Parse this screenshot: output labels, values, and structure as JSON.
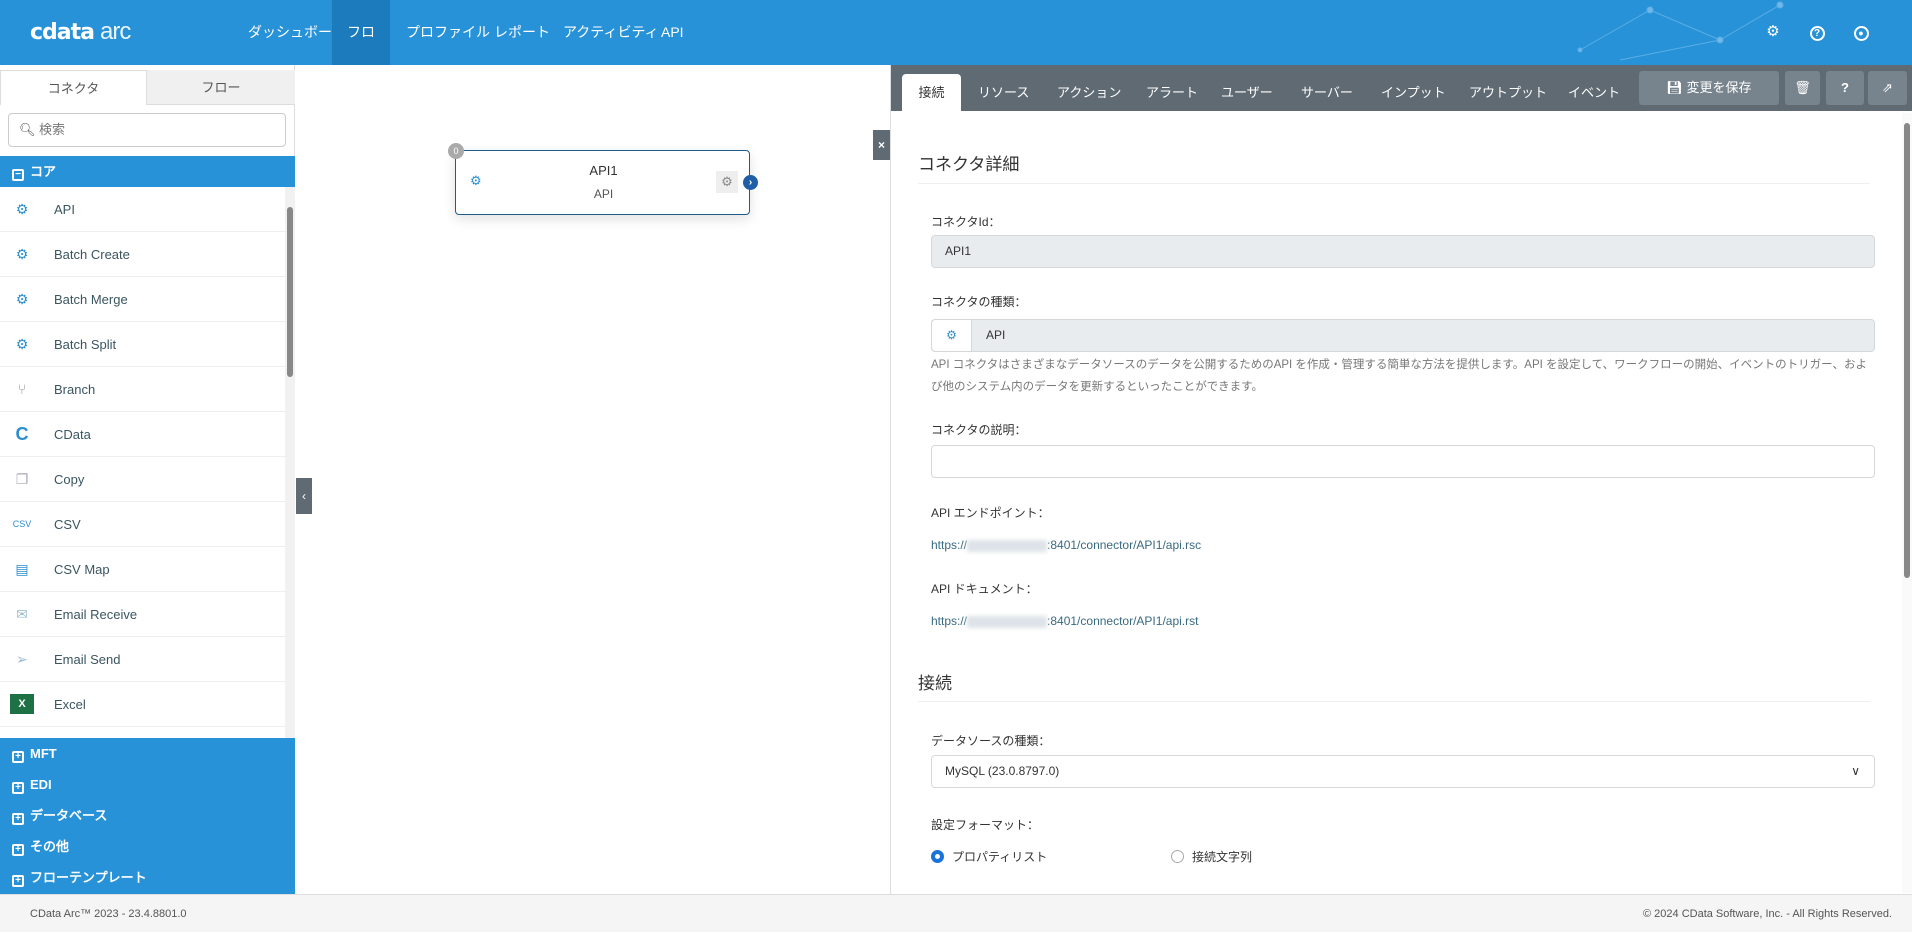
{
  "header": {
    "logo": "cdata",
    "logo_suffix": "arc",
    "nav": [
      "ダッシュボード",
      "フロー",
      "プロファイル",
      "レポート",
      "アクティビティ",
      "API"
    ],
    "active_nav": "フロー"
  },
  "left": {
    "tabs": [
      "コネクタ",
      "フロー"
    ],
    "search_placeholder": "検索",
    "core": "コア",
    "items": [
      "API",
      "Batch Create",
      "Batch Merge",
      "Batch Split",
      "Branch",
      "CData",
      "Copy",
      "CSV",
      "CSV Map",
      "Email Receive",
      "Email Send",
      "Excel"
    ],
    "categories": [
      "MFT",
      "EDI",
      "データベース",
      "その他",
      "フローテンプレート"
    ]
  },
  "canvas": {
    "node": {
      "name": "API1",
      "type": "API",
      "badge": "0"
    },
    "close": "×"
  },
  "right": {
    "tabs": [
      "接続",
      "リソース",
      "アクション",
      "アラート",
      "ユーザー",
      "サーバー",
      "インプット",
      "アウトプット",
      "イベント"
    ],
    "save": "変更を保存",
    "section1": "コネクタ詳細",
    "id_label": "コネクタId：",
    "id_value": "API1",
    "type_label": "コネクタの種類：",
    "type_value": "API",
    "description": "API コネクタはさまざまなデータソースのデータを公開するためのAPI を作成・管理する簡単な方法を提供します。API を設定して、ワークフローの開始、イベントのトリガー、および他のシステム内のデータを更新するといったことができます。",
    "desc_label": "コネクタの説明：",
    "desc_value": "",
    "endpoint_label": "API エンドポイント：",
    "endpoint_prefix": "https://",
    "endpoint_suffix": ":8401/connector/API1/api.rsc",
    "doc_label": "API ドキュメント：",
    "doc_prefix": "https://",
    "doc_suffix": ":8401/connector/API1/api.rst",
    "section2": "接続",
    "ds_label": "データソースの種類：",
    "ds_value": "MySQL (23.0.8797.0)",
    "format_label": "設定フォーマット：",
    "radio1": "プロパティリスト",
    "radio2": "接続文字列"
  },
  "footer": {
    "left": "CData Arc™ 2023 - 23.4.8801.0",
    "right": "© 2024 CData Software, Inc. - All Rights Reserved."
  }
}
